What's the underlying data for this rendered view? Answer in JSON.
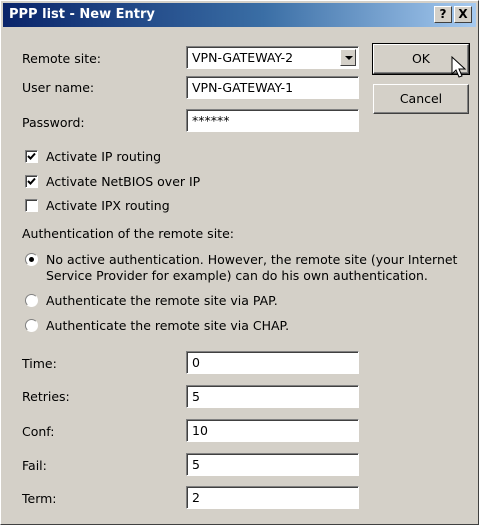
{
  "window": {
    "title": "PPP list - New Entry",
    "help_label": "?",
    "close_label": "X"
  },
  "buttons": {
    "ok_label": "OK",
    "cancel_label": "Cancel"
  },
  "fields": {
    "remote_site": {
      "label": "Remote site:",
      "value": "VPN-GATEWAY-2"
    },
    "user_name": {
      "label": "User name:",
      "value": "VPN-GATEWAY-1"
    },
    "password": {
      "label": "Password:",
      "value": "******"
    }
  },
  "checkboxes": [
    {
      "label": "Activate IP routing",
      "checked": true
    },
    {
      "label": "Activate NetBIOS over IP",
      "checked": true
    },
    {
      "label": "Activate IPX routing",
      "checked": false
    }
  ],
  "auth": {
    "heading": "Authentication of the remote site:",
    "options": [
      {
        "line1": "No active authentication. However, the remote site (your Internet",
        "line2": "Service Provider for example) can do his own authentication.",
        "selected": true
      },
      {
        "line1": "Authenticate the remote site via PAP.",
        "selected": false
      },
      {
        "line1": "Authenticate the remote site via CHAP.",
        "selected": false
      }
    ]
  },
  "timing": [
    {
      "label": "Time:",
      "value": "0"
    },
    {
      "label": "Retries:",
      "value": "5"
    },
    {
      "label": "Conf:",
      "value": "10"
    },
    {
      "label": "Fail:",
      "value": "5"
    },
    {
      "label": "Term:",
      "value": "2"
    }
  ]
}
